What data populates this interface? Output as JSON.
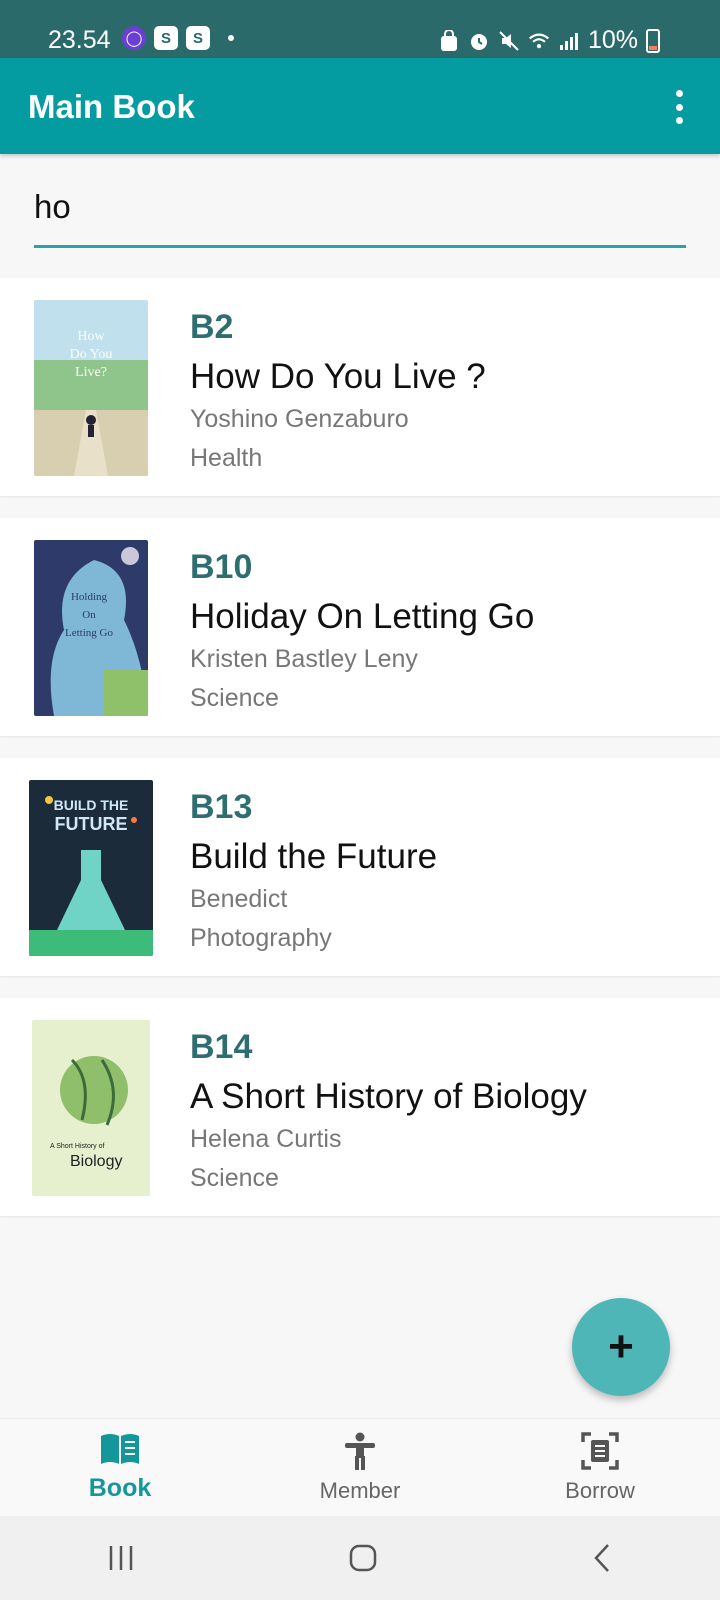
{
  "status_bar": {
    "time": "23.54",
    "battery": "10%",
    "left_icons": [
      "onedrive-icon",
      "shopee-icon",
      "shopee-icon"
    ],
    "right_icons": [
      "screen-lock-icon",
      "alarm-icon",
      "mute-icon",
      "wifi-icon",
      "signal-icon"
    ]
  },
  "app_bar": {
    "title": "Main Book",
    "menu_icon": "more-vert-icon"
  },
  "search": {
    "value": "ho"
  },
  "books": [
    {
      "code": "B2",
      "title": "How Do You Live ?",
      "author": "Yoshino Genzaburo",
      "category": "Health"
    },
    {
      "code": "B10",
      "title": "Holiday On Letting Go",
      "author": "Kristen Bastley Leny",
      "category": "Science"
    },
    {
      "code": "B13",
      "title": "Build the Future",
      "author": "Benedict",
      "category": "Photography"
    },
    {
      "code": "B14",
      "title": "A Short History of Biology",
      "author": "Helena Curtis",
      "category": "Science"
    }
  ],
  "fab": {
    "label": "+"
  },
  "bottom_nav": [
    {
      "label": "Book",
      "icon": "book-open-icon",
      "active": true
    },
    {
      "label": "Member",
      "icon": "person-icon",
      "active": false
    },
    {
      "label": "Borrow",
      "icon": "scan-document-icon",
      "active": false
    }
  ],
  "colors": {
    "status_bar": "#2b6a6b",
    "app_bar": "#049ca0",
    "accent": "#14979b",
    "fab": "#4fb6b8",
    "code_text": "#2f6e70"
  }
}
